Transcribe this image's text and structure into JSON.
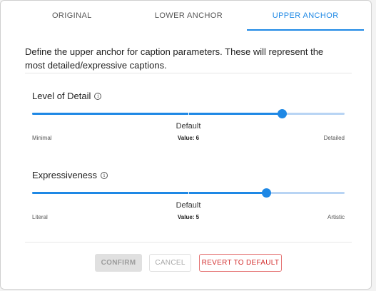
{
  "tabs": [
    {
      "label": "ORIGINAL",
      "active": false
    },
    {
      "label": "LOWER ANCHOR",
      "active": false
    },
    {
      "label": "UPPER ANCHOR",
      "active": true
    }
  ],
  "description": "Define the upper anchor for caption parameters. These will represent the most detailed/expressive captions.",
  "accent_color": "#1e88e5",
  "parameters": [
    {
      "label": "Level of Detail",
      "info_icon": "info-icon",
      "default_label": "Default",
      "value_text": "Value: 6",
      "min_label": "Minimal",
      "max_label": "Detailed",
      "value_fraction": 0.8,
      "default_fraction": 0.5
    },
    {
      "label": "Expressiveness",
      "info_icon": "info-icon",
      "default_label": "Default",
      "value_text": "Value: 5",
      "min_label": "Literal",
      "max_label": "Artistic",
      "value_fraction": 0.75,
      "default_fraction": 0.5
    }
  ],
  "actions": {
    "confirm": "CONFIRM",
    "cancel": "CANCEL",
    "revert": "REVERT TO DEFAULT"
  }
}
